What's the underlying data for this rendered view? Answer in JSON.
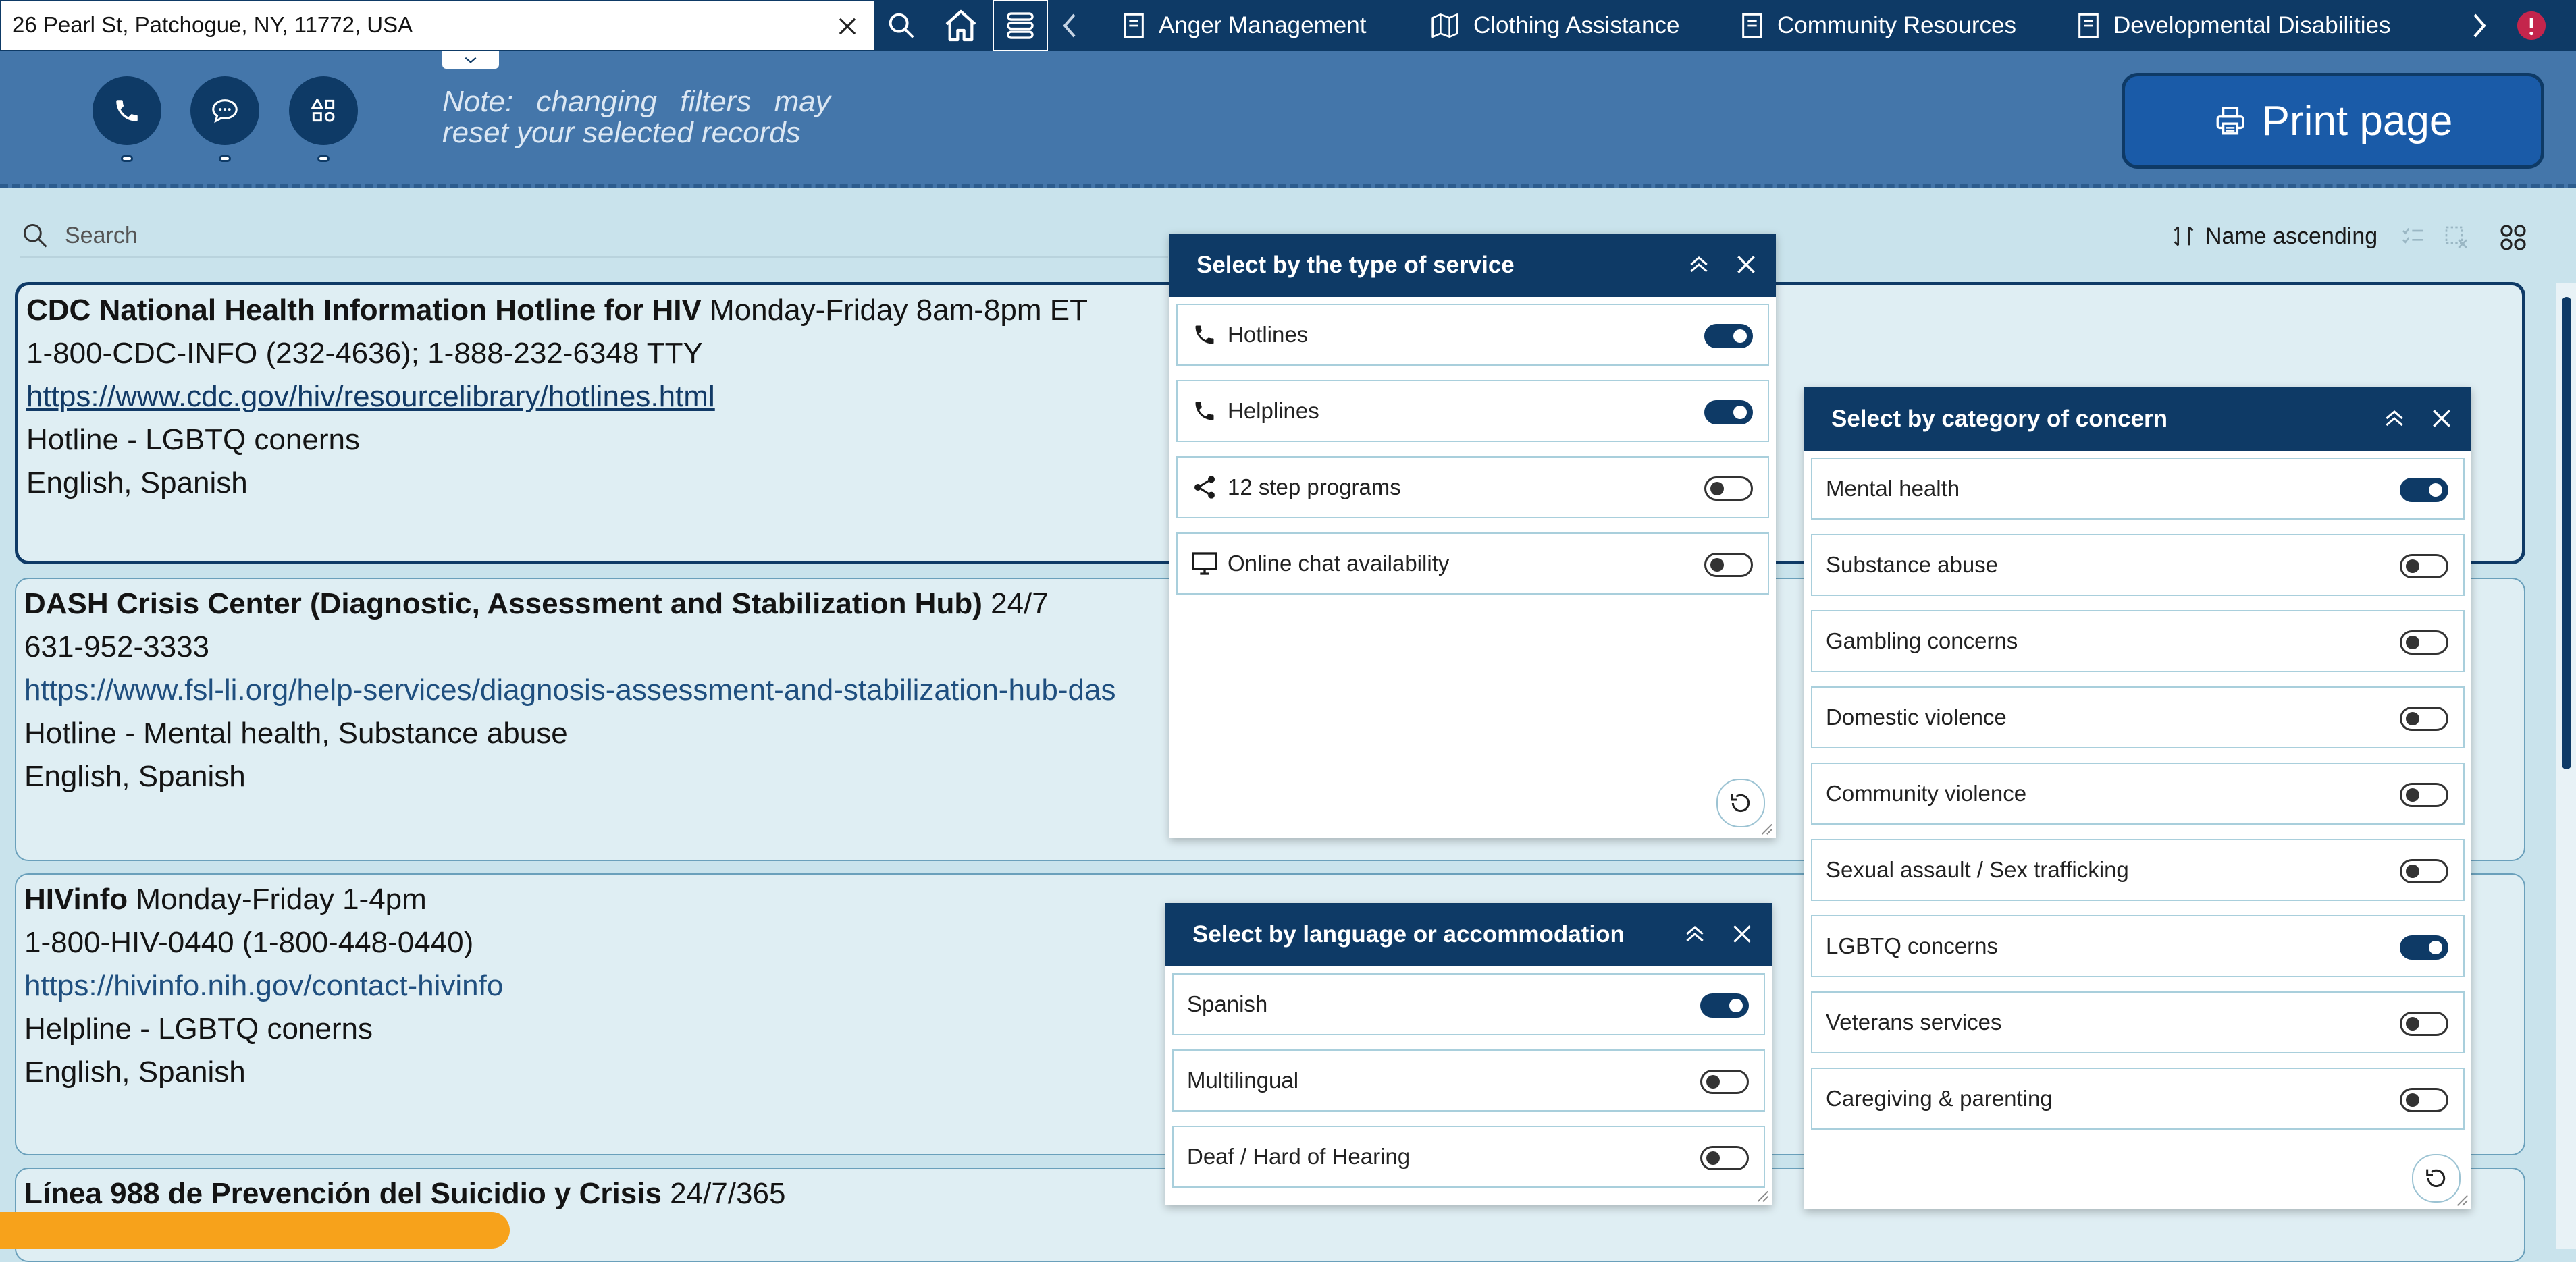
{
  "address": {
    "value": "26 Pearl St, Patchogue, NY, 11772, USA"
  },
  "tabs": [
    {
      "label": "Anger Management",
      "icon": "document-icon"
    },
    {
      "label": "Clothing Assistance",
      "icon": "map-icon"
    },
    {
      "label": "Community Resources",
      "icon": "document-icon"
    },
    {
      "label": "Developmental Disabilities",
      "icon": "document-icon"
    }
  ],
  "header": {
    "note_line1": "Note: changing filters may",
    "note_line2": "reset your selected records",
    "print_label": "Print page"
  },
  "search": {
    "placeholder": "Search"
  },
  "sort": {
    "label": "Name ascending"
  },
  "records": [
    {
      "name": "CDC National Health Information Hotline for HIV",
      "hours": "Monday-Friday 8am-8pm ET",
      "phone": "1-800-CDC-INFO (232-4636); 1-888-232-6348 TTY",
      "url": "https://www.cdc.gov/hiv/resourcelibrary/hotlines.html",
      "category": "Hotline - LGBTQ conerns",
      "languages": "English, Spanish"
    },
    {
      "name": "DASH Crisis Center (Diagnostic, Assessment and Stabilization Hub)",
      "hours": "24/7",
      "phone": "631-952-3333",
      "url": "https://www.fsl-li.org/help-services/diagnosis-assessment-and-stabilization-hub-das",
      "category": "Hotline - Mental health, Substance abuse",
      "languages": "English, Spanish"
    },
    {
      "name": "HIVinfo",
      "hours": "Monday-Friday 1-4pm",
      "phone": "1-800-HIV-0440 (1-800-448-0440)",
      "url": "https://hivinfo.nih.gov/contact-hivinfo",
      "category": "Helpline - LGBTQ conerns",
      "languages": "English, Spanish"
    },
    {
      "name": "Línea 988 de Prevención del Suicidio y Crisis",
      "hours": "24/7/365"
    }
  ],
  "service_panel": {
    "title": "Select by the type of service",
    "items": [
      {
        "label": "Hotlines",
        "on": true
      },
      {
        "label": "Helplines",
        "on": true
      },
      {
        "label": "12 step programs",
        "on": false
      },
      {
        "label": "Online chat availability",
        "on": false
      }
    ]
  },
  "language_panel": {
    "title": "Select by language or accommodation",
    "items": [
      {
        "label": "Spanish",
        "on": true
      },
      {
        "label": "Multilingual",
        "on": false
      },
      {
        "label": "Deaf / Hard of Hearing",
        "on": false
      }
    ]
  },
  "concern_panel": {
    "title": "Select by category of concern",
    "items": [
      {
        "label": "Mental health",
        "on": true
      },
      {
        "label": "Substance abuse",
        "on": false
      },
      {
        "label": "Gambling concerns",
        "on": false
      },
      {
        "label": "Domestic violence",
        "on": false
      },
      {
        "label": "Community violence",
        "on": false
      },
      {
        "label": "Sexual assault / Sex trafficking",
        "on": false
      },
      {
        "label": "LGBTQ concerns",
        "on": true
      },
      {
        "label": "Veterans services",
        "on": false
      },
      {
        "label": "Caregiving & parenting",
        "on": false
      }
    ]
  },
  "colors": {
    "navy": "#0e3a66",
    "header_blue": "#4476aa",
    "background": "#c9e3ec",
    "accent_orange": "#f7a21b"
  }
}
